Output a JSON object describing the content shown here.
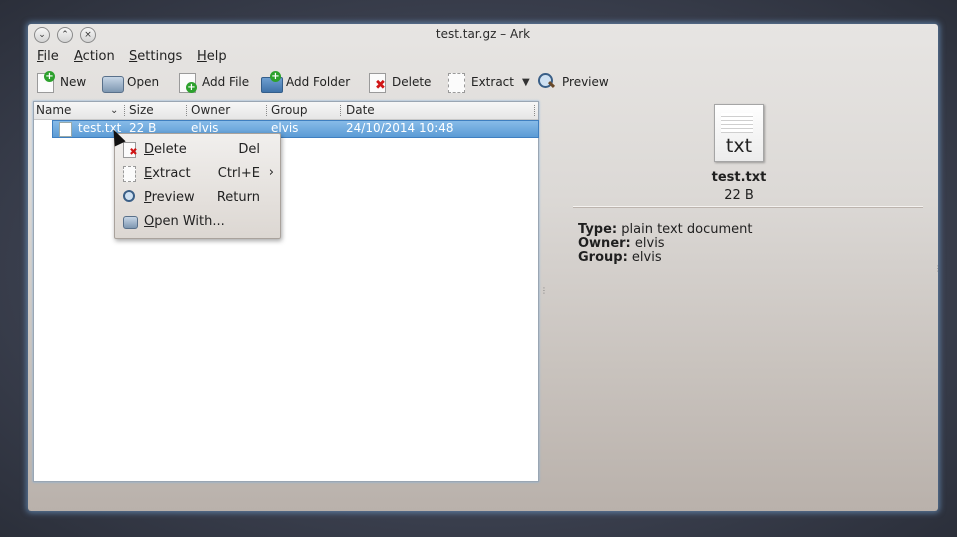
{
  "window": {
    "title": "test.tar.gz – Ark"
  },
  "titlebar_buttons": [
    "⌄",
    "⌃",
    "×"
  ],
  "menubar": [
    "File",
    "Action",
    "Settings",
    "Help"
  ],
  "toolbar": {
    "new": "New",
    "open": "Open",
    "add_file": "Add File",
    "add_folder": "Add Folder",
    "delete": "Delete",
    "extract": "Extract",
    "preview": "Preview"
  },
  "list": {
    "columns": [
      "Name",
      "Size",
      "Owner",
      "Group",
      "Date"
    ],
    "rows": [
      {
        "name": "test.txt",
        "size": "22 B",
        "owner": "elvis",
        "group": "elvis",
        "date": "24/10/2014 10:48"
      }
    ]
  },
  "context_menu": [
    {
      "label": "Delete",
      "shortcut": "Del"
    },
    {
      "label": "Extract",
      "shortcut": "Ctrl+E"
    },
    {
      "label": "Preview",
      "shortcut": "Return"
    },
    {
      "label": "Open With...",
      "shortcut": ""
    }
  ],
  "details": {
    "icon_label": "txt",
    "filename": "test.txt",
    "size": "22 B",
    "type_label": "Type:",
    "type_value": "plain text document",
    "owner_label": "Owner:",
    "owner_value": "elvis",
    "group_label": "Group:",
    "group_value": "elvis"
  },
  "colors": {
    "selection": "#5b9bd5",
    "focus_glow": "#7fb0e0"
  }
}
